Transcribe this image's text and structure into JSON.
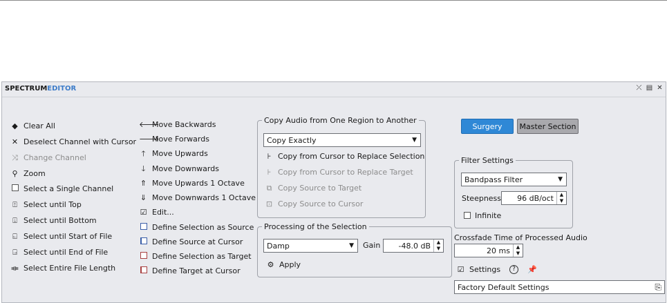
{
  "title": {
    "part1": "SPECTRUM",
    "part2": "EDITOR"
  },
  "window_controls": {
    "collapse": "⤫",
    "menu": "▤",
    "close": "✕"
  },
  "left_column": [
    {
      "label": "Clear All",
      "icon": "eraser-icon"
    },
    {
      "label": "Deselect Channel with Cursor",
      "icon": "x-icon"
    },
    {
      "label": "Change Channel",
      "icon": "shuffle-icon",
      "disabled": true
    },
    {
      "label": "Zoom",
      "icon": "magnifier-icon"
    },
    {
      "label": "Select a Single Channel",
      "icon": "square-icon"
    },
    {
      "label": "Select until Top",
      "icon": "select-top-icon"
    },
    {
      "label": "Select until Bottom",
      "icon": "select-bottom-icon"
    },
    {
      "label": "Select until Start of File",
      "icon": "select-start-icon"
    },
    {
      "label": "Select until End of File",
      "icon": "select-end-icon"
    },
    {
      "label": "Select Entire File Length",
      "icon": "select-all-icon"
    }
  ],
  "middle_column": [
    {
      "label": "Move Backwards",
      "icon": "arrow-left-icon"
    },
    {
      "label": "Move Forwards",
      "icon": "arrow-right-icon"
    },
    {
      "label": "Move Upwards",
      "icon": "arrow-up-icon"
    },
    {
      "label": "Move Downwards",
      "icon": "arrow-down-icon"
    },
    {
      "label": "Move Upwards 1 Octave",
      "icon": "octave-up-icon"
    },
    {
      "label": "Move Downwards 1 Octave",
      "icon": "octave-down-icon"
    },
    {
      "label": "Edit...",
      "icon": "edit-check-icon"
    },
    {
      "label": "Define Selection as Source",
      "icon": "source-selection-icon"
    },
    {
      "label": "Define Source at Cursor",
      "icon": "source-cursor-icon"
    },
    {
      "label": "Define Selection as Target",
      "icon": "target-selection-icon"
    },
    {
      "label": "Define Target at Cursor",
      "icon": "target-cursor-icon"
    }
  ],
  "copy_group": {
    "legend": "Copy Audio from One Region to Another",
    "mode": "Copy Exactly",
    "items": [
      {
        "label": "Copy from Cursor to Replace Selection",
        "disabled": false
      },
      {
        "label": "Copy from Cursor to Replace Target",
        "disabled": true
      },
      {
        "label": "Copy Source to Target",
        "disabled": true
      },
      {
        "label": "Copy Source to Cursor",
        "disabled": true
      }
    ]
  },
  "processing_group": {
    "legend": "Processing of the Selection",
    "mode": "Damp",
    "gain_label": "Gain",
    "gain_value": "-48.0 dB",
    "apply_label": "Apply"
  },
  "buttons": {
    "surgery": "Surgery",
    "master_section": "Master Section"
  },
  "filter_group": {
    "legend": "Filter Settings",
    "filter_type": "Bandpass Filter",
    "steepness_label": "Steepness",
    "steepness_value": "96 dB/oct",
    "infinite_label": "Infinite"
  },
  "crossfade": {
    "label": "Crossfade Time of Processed Audio",
    "value": "20 ms"
  },
  "settings": {
    "label": "Settings"
  },
  "preset": {
    "value": "Factory Default Settings"
  },
  "colors": {
    "accent": "#2f88d6",
    "title_accent": "#3d7cc9",
    "panel_bg": "#e9eaee"
  }
}
